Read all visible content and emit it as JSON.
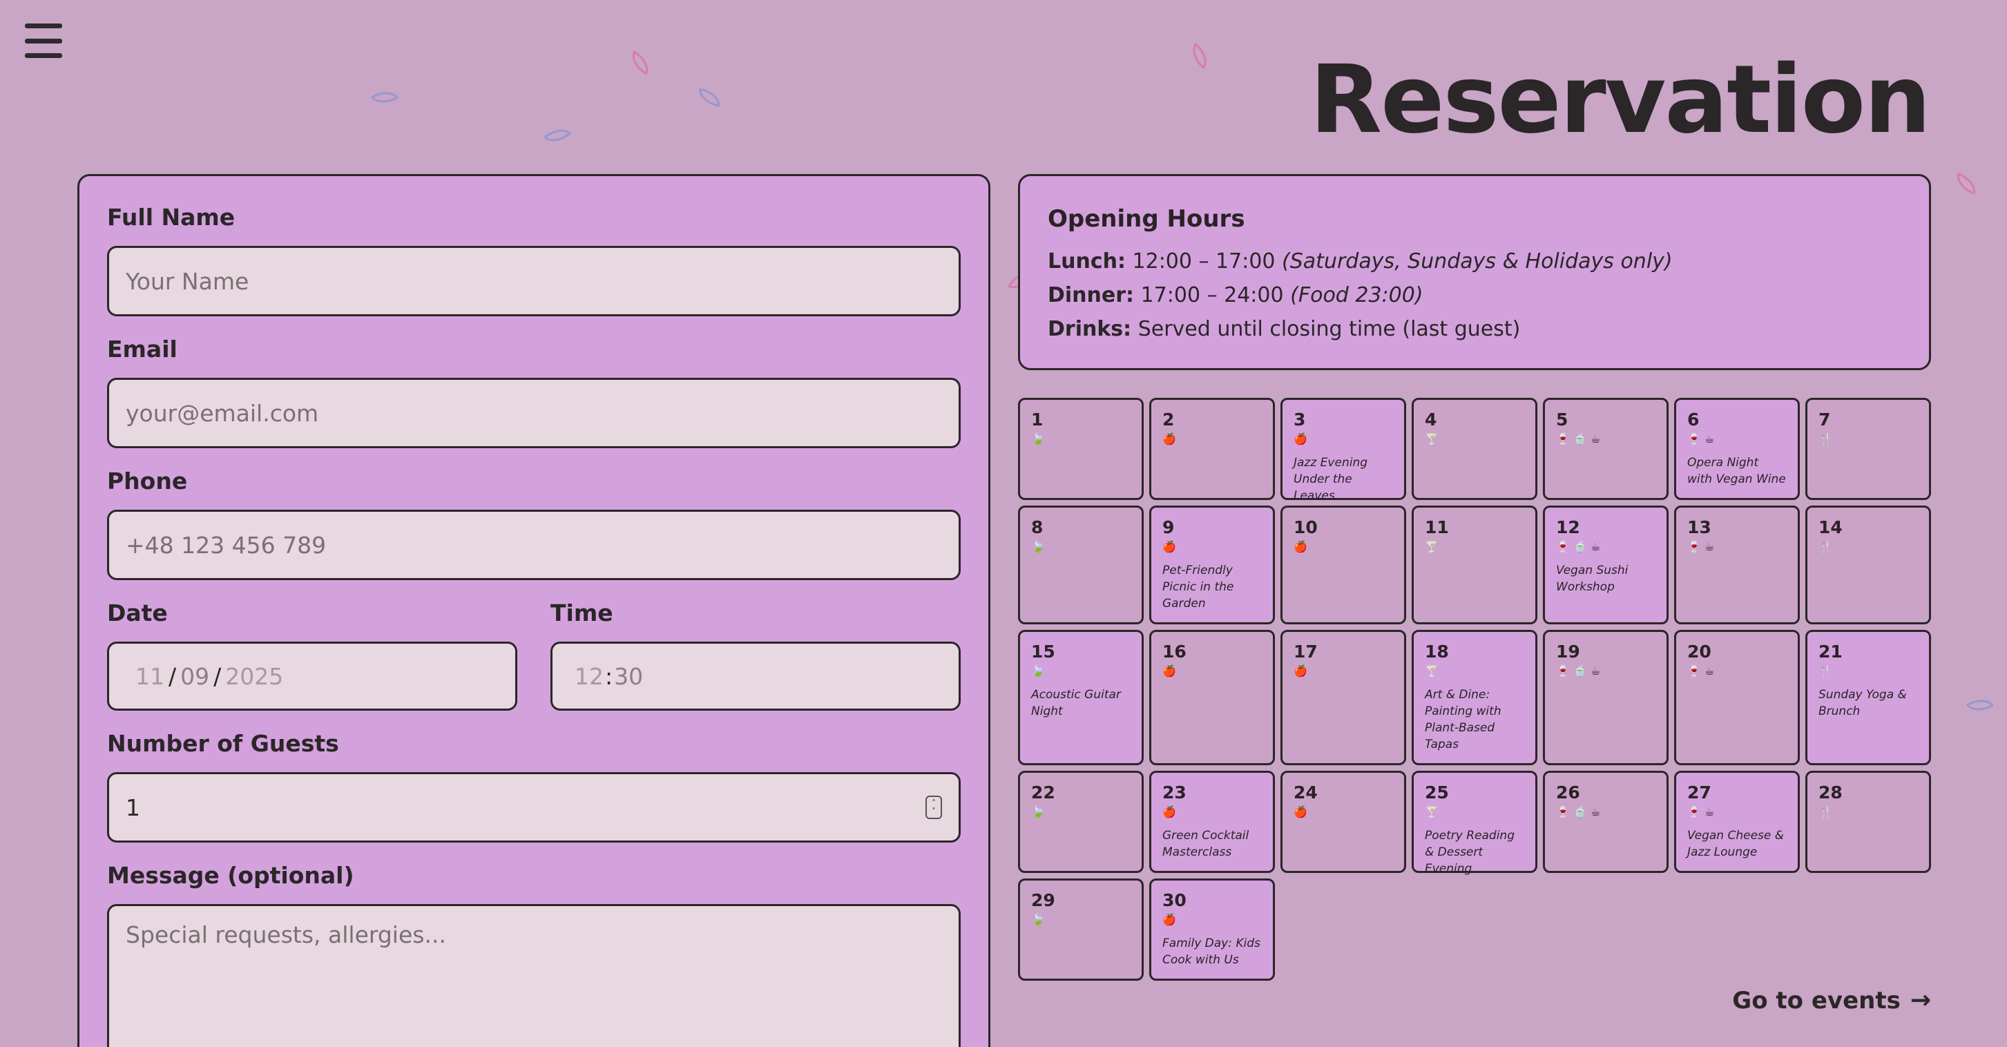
{
  "page": {
    "title": "Reservation"
  },
  "menu": {
    "icon": "hamburger-menu-icon"
  },
  "form": {
    "full_name": {
      "label": "Full Name",
      "placeholder": "Your Name"
    },
    "email": {
      "label": "Email",
      "placeholder": "your@email.com"
    },
    "phone": {
      "label": "Phone",
      "placeholder": "+48 123 456 789"
    },
    "date": {
      "label": "Date",
      "day": "11",
      "month": "09",
      "year": "2025",
      "sep": "/"
    },
    "time": {
      "label": "Time",
      "hour": "12",
      "minute": "30",
      "sep": ":"
    },
    "guests": {
      "label": "Number of Guests",
      "value": "1"
    },
    "message": {
      "label": "Message (optional)",
      "placeholder": "Special requests, allergies..."
    }
  },
  "hours": {
    "title": "Opening Hours",
    "lunch": {
      "label": "Lunch:",
      "time": "12:00 – 17:00",
      "note": "(Saturdays, Sundays & Holidays only)"
    },
    "dinner": {
      "label": "Dinner:",
      "time": "17:00 – 24:00",
      "note": "(Food 23:00)"
    },
    "drinks": {
      "label": "Drinks:",
      "time": "Served until closing time (last guest)"
    }
  },
  "calendar": {
    "days": [
      {
        "day": "1",
        "icons": "🍃",
        "event": ""
      },
      {
        "day": "2",
        "icons": "🍎",
        "event": ""
      },
      {
        "day": "3",
        "icons": "🍎",
        "event": "Jazz Evening Under the Leaves"
      },
      {
        "day": "4",
        "icons": "🍸",
        "event": ""
      },
      {
        "day": "5",
        "icons": "🍷 🍵 ☕",
        "event": ""
      },
      {
        "day": "6",
        "icons": "🍷 ☕",
        "event": "Opera Night with Vegan Wine"
      },
      {
        "day": "7",
        "icons": "🍴",
        "event": ""
      },
      {
        "day": "8",
        "icons": "🍃",
        "event": ""
      },
      {
        "day": "9",
        "icons": "🍎",
        "event": "Pet-Friendly Picnic in the Garden"
      },
      {
        "day": "10",
        "icons": "🍎",
        "event": ""
      },
      {
        "day": "11",
        "icons": "🍸",
        "event": ""
      },
      {
        "day": "12",
        "icons": "🍷 🍵 ☕",
        "event": "Vegan Sushi Workshop"
      },
      {
        "day": "13",
        "icons": "🍷 ☕",
        "event": ""
      },
      {
        "day": "14",
        "icons": "🍴",
        "event": ""
      },
      {
        "day": "15",
        "icons": "🍃",
        "event": "Acoustic Guitar Night"
      },
      {
        "day": "16",
        "icons": "🍎",
        "event": ""
      },
      {
        "day": "17",
        "icons": "🍎",
        "event": ""
      },
      {
        "day": "18",
        "icons": "🍸",
        "event": "Art & Dine: Painting with Plant-Based Tapas"
      },
      {
        "day": "19",
        "icons": "🍷 🍵 ☕",
        "event": ""
      },
      {
        "day": "20",
        "icons": "🍷 ☕",
        "event": ""
      },
      {
        "day": "21",
        "icons": "🍴",
        "event": "Sunday Yoga & Brunch"
      },
      {
        "day": "22",
        "icons": "🍃",
        "event": ""
      },
      {
        "day": "23",
        "icons": "🍎",
        "event": "Green Cocktail Masterclass"
      },
      {
        "day": "24",
        "icons": "🍎",
        "event": ""
      },
      {
        "day": "25",
        "icons": "🍸",
        "event": "Poetry Reading & Dessert Evening"
      },
      {
        "day": "26",
        "icons": "🍷 🍵 ☕",
        "event": ""
      },
      {
        "day": "27",
        "icons": "🍷 ☕",
        "event": "Vegan Cheese & Jazz Lounge"
      },
      {
        "day": "28",
        "icons": "🍴",
        "event": ""
      },
      {
        "day": "29",
        "icons": "🍃",
        "event": ""
      },
      {
        "day": "30",
        "icons": "🍎",
        "event": "Family Day: Kids Cook with Us"
      }
    ]
  },
  "footer": {
    "go_events": "Go to events",
    "arrow": "→"
  }
}
